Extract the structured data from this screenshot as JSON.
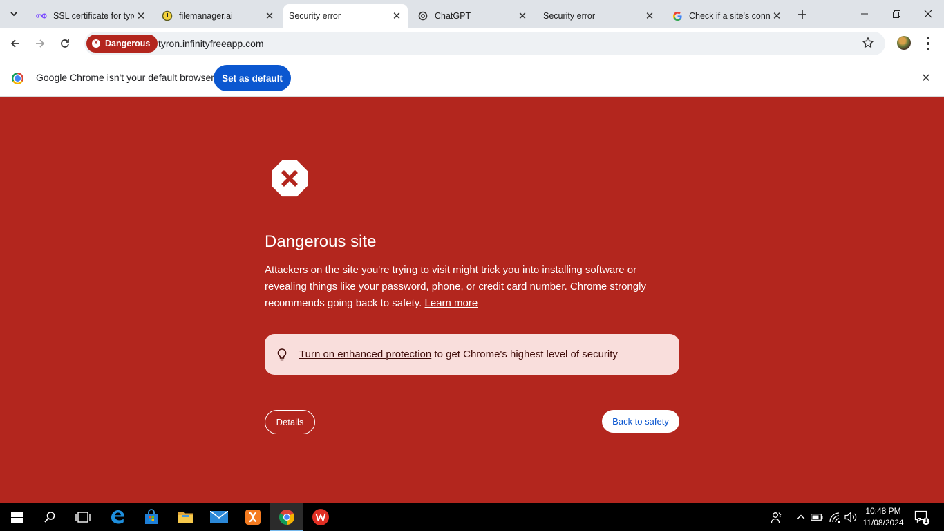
{
  "tabs": [
    {
      "title": "SSL certificate for tyrc",
      "icon": "infinity-icon",
      "active": false
    },
    {
      "title": "filemanager.ai",
      "icon": "filemanager-icon",
      "active": false
    },
    {
      "title": "Security error",
      "icon": "none",
      "active": true
    },
    {
      "title": "ChatGPT",
      "icon": "chatgpt-icon",
      "active": false
    },
    {
      "title": "Security error",
      "icon": "none",
      "active": false
    },
    {
      "title": "Check if a site's conn",
      "icon": "google-icon",
      "active": false
    }
  ],
  "toolbar": {
    "danger_label": "Dangerous",
    "url": "tyron.infinityfreeapp.com"
  },
  "infobar": {
    "message": "Google Chrome isn't your default browser",
    "set_default_label": "Set as default"
  },
  "interstitial": {
    "heading": "Dangerous site",
    "description": "Attackers on the site you're trying to visit might trick you into installing software or revealing things like your password, phone, or credit card number. Chrome strongly recommends going back to safety.",
    "learn_more": "Learn more",
    "enhanced_link": "Turn on enhanced protection",
    "enhanced_rest": " to get Chrome's highest level of security",
    "details_label": "Details",
    "back_label": "Back to safety"
  },
  "taskbar": {
    "time": "10:48 PM",
    "date": "11/08/2024",
    "notification_count": "1"
  },
  "colors": {
    "danger_red": "#b3261e",
    "primary_blue": "#0b57d0",
    "enhanced_bg": "#f9dedc"
  }
}
